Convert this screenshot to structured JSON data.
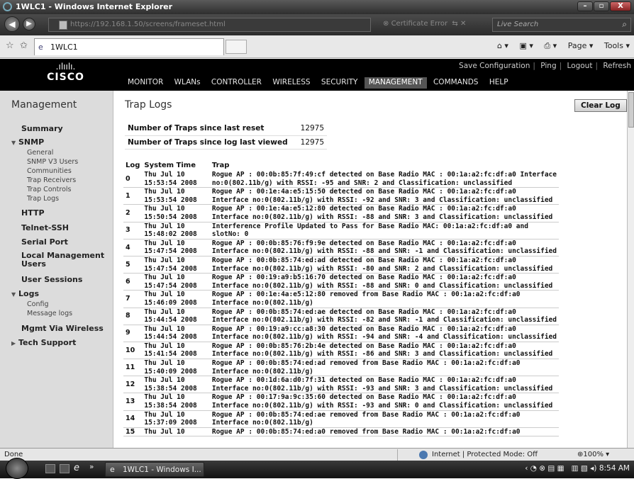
{
  "window": {
    "title": "1WLC1 - Windows Internet Explorer",
    "min": "–",
    "max": "▫",
    "close": "X"
  },
  "browser": {
    "back": "◀",
    "forward": "▶",
    "address": "https://192.168.1.50/screens/frameset.html",
    "certificate": "Certificate Error",
    "search_placeholder": "Live Search",
    "tab_label": "1WLC1",
    "commands": [
      "Page ▾",
      "Tools ▾"
    ]
  },
  "header": {
    "logo_bars": ".ılıılı.",
    "logo_text": "cisco",
    "links": [
      "Save Configuration",
      "Ping",
      "Logout",
      "Refresh"
    ],
    "nav": [
      "MONITOR",
      "WLANs",
      "CONTROLLER",
      "WIRELESS",
      "SECURITY",
      "MANAGEMENT",
      "COMMANDS",
      "HELP"
    ],
    "active_nav": "MANAGEMENT"
  },
  "sidebar": {
    "title": "Management",
    "items": {
      "summary": "Summary",
      "snmp": "SNMP",
      "snmp_sub": [
        "General",
        "SNMP V3 Users",
        "Communities",
        "Trap Receivers",
        "Trap Controls",
        "Trap Logs"
      ],
      "http": "HTTP",
      "telnet": "Telnet-SSH",
      "serial": "Serial Port",
      "local_mgmt": "Local Management Users",
      "user_sessions": "User Sessions",
      "logs": "Logs",
      "logs_sub": [
        "Config",
        "Message logs"
      ],
      "mgmt_wireless": "Mgmt Via Wireless",
      "tech_support": "Tech Support"
    }
  },
  "main": {
    "title": "Trap Logs",
    "clear_button": "Clear Log",
    "counts": [
      {
        "label": "Number of Traps since last reset",
        "value": "12975"
      },
      {
        "label": "Number of Traps since log last viewed",
        "value": "12975"
      }
    ],
    "columns": [
      "Log",
      "System Time",
      "Trap"
    ],
    "rows": [
      {
        "log": "0",
        "date": "Thu Jul 10",
        "time": "15:53:54 2008",
        "trap1": "Rogue AP : 00:0b:85:7f:49:cf detected on Base Radio MAC : 00:1a:a2:fc:df:a0 Interface",
        "trap2": "no:0(802.11b/g) with RSSI: -95 and SNR: 2 and Classification: unclassified"
      },
      {
        "log": "1",
        "date": "Thu Jul 10",
        "time": "15:53:54 2008",
        "trap1": "Rogue AP : 00:1e:4a:e5:15:50 detected on Base Radio MAC : 00:1a:a2:fc:df:a0",
        "trap2": "Interface no:0(802.11b/g) with RSSI: -92 and SNR: 3 and Classification: unclassified"
      },
      {
        "log": "2",
        "date": "Thu Jul 10",
        "time": "15:50:54 2008",
        "trap1": "Rogue AP : 00:1e:4a:e5:12:80 detected on Base Radio MAC : 00:1a:a2:fc:df:a0",
        "trap2": "Interface no:0(802.11b/g) with RSSI: -88 and SNR: 3 and Classification: unclassified"
      },
      {
        "log": "3",
        "date": "Thu Jul 10",
        "time": "15:48:02 2008",
        "trap1": "Interference Profile Updated to Pass for Base Radio MAC: 00:1a:a2:fc:df:a0 and",
        "trap2": "slotNo: 0"
      },
      {
        "log": "4",
        "date": "Thu Jul 10",
        "time": "15:47:54 2008",
        "trap1": "Rogue AP : 00:0b:85:76:f9:9e detected on Base Radio MAC : 00:1a:a2:fc:df:a0",
        "trap2": "Interface no:0(802.11b/g) with RSSI: -88 and SNR: -1 and Classification: unclassified"
      },
      {
        "log": "5",
        "date": "Thu Jul 10",
        "time": "15:47:54 2008",
        "trap1": "Rogue AP : 00:0b:85:74:ed:ad detected on Base Radio MAC : 00:1a:a2:fc:df:a0",
        "trap2": "Interface no:0(802.11b/g) with RSSI: -80 and SNR: 2 and Classification: unclassified"
      },
      {
        "log": "6",
        "date": "Thu Jul 10",
        "time": "15:47:54 2008",
        "trap1": "Rogue AP : 00:19:a9:b5:16:70 detected on Base Radio MAC : 00:1a:a2:fc:df:a0",
        "trap2": "Interface no:0(802.11b/g) with RSSI: -88 and SNR: 0 and Classification: unclassified"
      },
      {
        "log": "7",
        "date": "Thu Jul 10",
        "time": "15:46:09 2008",
        "trap1": "Rogue AP : 00:1e:4a:e5:12:80 removed from Base Radio MAC : 00:1a:a2:fc:df:a0",
        "trap2": "Interface no:0(802.11b/g)"
      },
      {
        "log": "8",
        "date": "Thu Jul 10",
        "time": "15:44:54 2008",
        "trap1": "Rogue AP : 00:0b:85:74:ed:ae detected on Base Radio MAC : 00:1a:a2:fc:df:a0",
        "trap2": "Interface no:0(802.11b/g) with RSSI: -82 and SNR: -1 and Classification: unclassified"
      },
      {
        "log": "9",
        "date": "Thu Jul 10",
        "time": "15:44:54 2008",
        "trap1": "Rogue AP : 00:19:a9:cc:a8:30 detected on Base Radio MAC : 00:1a:a2:fc:df:a0",
        "trap2": "Interface no:0(802.11b/g) with RSSI: -94 and SNR: -4 and Classification: unclassified"
      },
      {
        "log": "10",
        "date": "Thu Jul 10",
        "time": "15:41:54 2008",
        "trap1": "Rogue AP : 00:0b:85:76:2b:4e detected on Base Radio MAC : 00:1a:a2:fc:df:a0",
        "trap2": "Interface no:0(802.11b/g) with RSSI: -86 and SNR: 3 and Classification: unclassified"
      },
      {
        "log": "11",
        "date": "Thu Jul 10",
        "time": "15:40:09 2008",
        "trap1": "Rogue AP : 00:0b:85:74:ed:ad removed from Base Radio MAC : 00:1a:a2:fc:df:a0",
        "trap2": "Interface no:0(802.11b/g)"
      },
      {
        "log": "12",
        "date": "Thu Jul 10",
        "time": "15:38:54 2008",
        "trap1": "Rogue AP : 00:1d:6a:d0:7f:31 detected on Base Radio MAC : 00:1a:a2:fc:df:a0",
        "trap2": "Interface no:0(802.11b/g) with RSSI: -93 and SNR: 3 and Classification: unclassified"
      },
      {
        "log": "13",
        "date": "Thu Jul 10",
        "time": "15:38:54 2008",
        "trap1": "Rogue AP : 00:17:9a:9c:35:60 detected on Base Radio MAC : 00:1a:a2:fc:df:a0",
        "trap2": "Interface no:0(802.11b/g) with RSSI: -93 and SNR: 0 and Classification: unclassified"
      },
      {
        "log": "14",
        "date": "Thu Jul 10",
        "time": "15:37:09 2008",
        "trap1": "Rogue AP : 00:0b:85:74:ed:ae removed from Base Radio MAC : 00:1a:a2:fc:df:a0",
        "trap2": "Interface no:0(802.11b/g)"
      },
      {
        "log": "15",
        "date": "Thu Jul 10",
        "time": "",
        "trap1": "Rogue AP : 00:0b:85:74:ed:a0 removed from Base Radio MAC : 00:1a:a2:fc:df:a0",
        "trap2": ""
      }
    ]
  },
  "status": {
    "left": "Done",
    "zone": "Internet | Protected Mode: Off",
    "zoom": "100%"
  },
  "taskbar": {
    "task": "1WLC1 - Windows I...",
    "clock": "8:54 AM"
  },
  "icons": [
    "ie-icon",
    "page-icon",
    "certificate-error-icon",
    "search-icon",
    "home-icon",
    "feeds-icon",
    "print-icon",
    "globe-icon",
    "start-orb-icon"
  ]
}
